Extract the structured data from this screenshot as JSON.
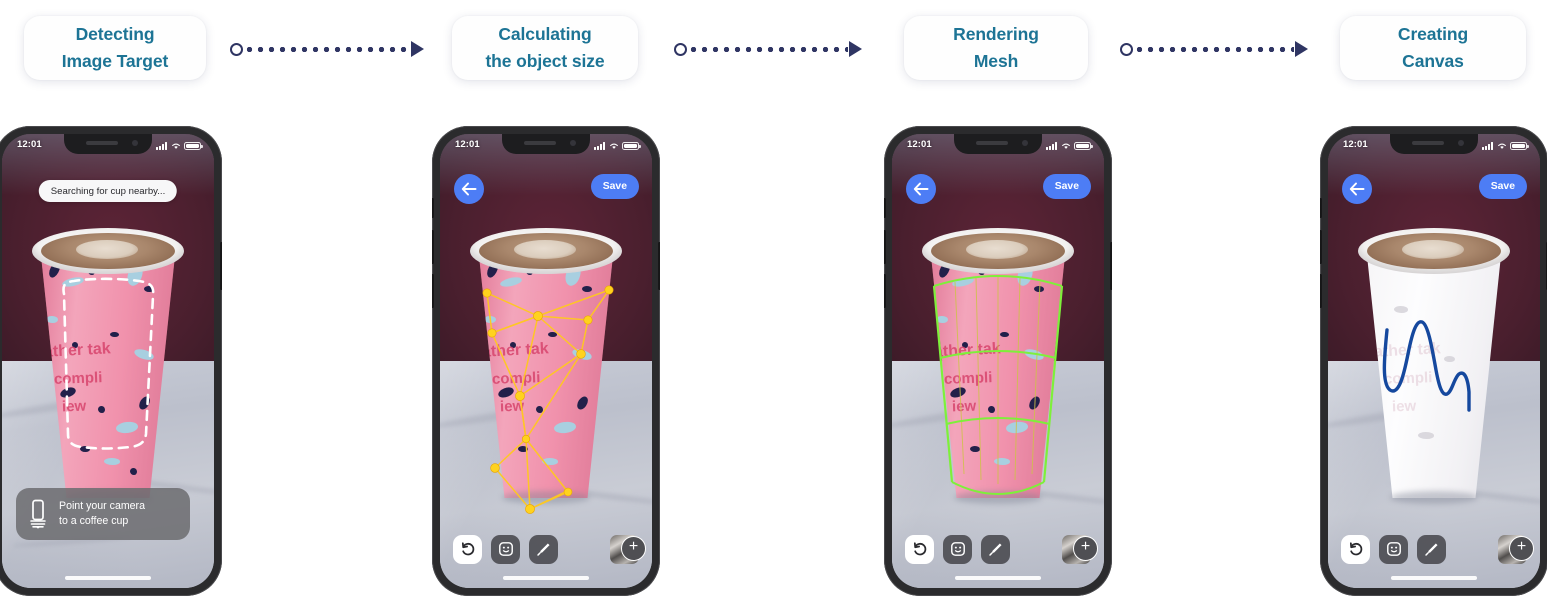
{
  "pipeline": {
    "steps": [
      {
        "id": "detecting",
        "line1": "Detecting",
        "line2": "Image Target"
      },
      {
        "id": "calculating",
        "line1": "Calculating",
        "line2": "the object size"
      },
      {
        "id": "rendering",
        "line1": "Rendering",
        "line2": "Mesh"
      },
      {
        "id": "creating",
        "line1": "Creating",
        "line2": "Canvas"
      }
    ],
    "connector_count": 3
  },
  "colors": {
    "step_label": "#1d7495",
    "connector": "#2f3563",
    "accent_blue": "#4d7df5",
    "mesh_green": "#7ef03a",
    "feature_yellow": "#ffd21e",
    "drawing_blue": "#15489e",
    "cup_pink": "#f08ca8"
  },
  "phones": [
    {
      "id": "phone-detecting",
      "status_bar": {
        "time": "12:01",
        "signal": "cellular-bars",
        "wifi": "wifi-icon",
        "battery": "battery-full"
      },
      "search_pill": "Searching for cup nearby...",
      "hint": {
        "icon": "phone-move-icon",
        "line1": "Point your camera",
        "line2": "to a coffee cup"
      },
      "has_top_actions": false,
      "has_toolbar": false,
      "overlay": "dashed-detection-outline",
      "cup_style": "pink-speckled"
    },
    {
      "id": "phone-calculating",
      "status_bar": {
        "time": "12:01",
        "signal": "cellular-bars",
        "wifi": "wifi-icon",
        "battery": "battery-full"
      },
      "back_label": "back",
      "save_label": "Save",
      "has_top_actions": true,
      "has_toolbar": true,
      "overlay": "yellow-feature-points",
      "cup_style": "pink-speckled"
    },
    {
      "id": "phone-rendering",
      "status_bar": {
        "time": "12:01",
        "signal": "cellular-bars",
        "wifi": "wifi-icon",
        "battery": "battery-full"
      },
      "back_label": "back",
      "save_label": "Save",
      "has_top_actions": true,
      "has_toolbar": true,
      "overlay": "green-mesh-wireframe",
      "cup_style": "pink-speckled"
    },
    {
      "id": "phone-creating",
      "status_bar": {
        "time": "12:01",
        "signal": "cellular-bars",
        "wifi": "wifi-icon",
        "battery": "battery-full"
      },
      "back_label": "back",
      "save_label": "Save",
      "has_top_actions": true,
      "has_toolbar": true,
      "overlay": "blue-hand-drawn-stroke",
      "cup_style": "blank-white"
    }
  ],
  "toolbar": {
    "items": [
      {
        "id": "undo",
        "icon": "undo-arrow-icon",
        "state": "active"
      },
      {
        "id": "sticker",
        "icon": "sticker-face-icon",
        "state": "dim"
      },
      {
        "id": "brush",
        "icon": "paintbrush-icon",
        "state": "dim"
      }
    ],
    "add_photo": {
      "icon": "plus-icon",
      "thumb": "photo-thumbnail"
    }
  },
  "cup_label": {
    "line1": "ather tak",
    "line2": "compli",
    "line3": "iew"
  }
}
